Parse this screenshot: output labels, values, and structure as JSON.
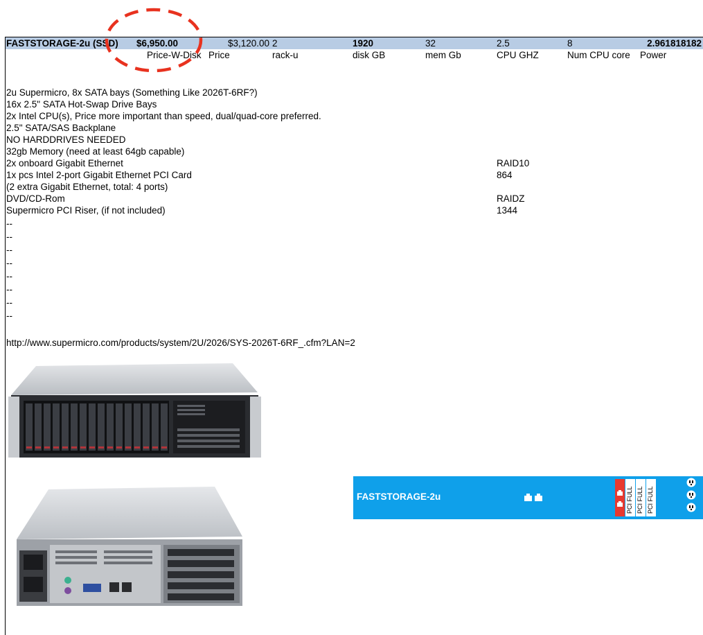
{
  "header_row": {
    "name": "FASTSTORAGE-2u",
    "tag": "(SSD)",
    "price_w_disk": "$6,950.00",
    "price": "$3,120.00",
    "rack_u": "2",
    "disk_gb": "1920",
    "mem_gb": "32",
    "cpu_ghz": "2.5",
    "num_cpu_core": "8",
    "power": "2.961818182"
  },
  "label_row": {
    "price_w_disk": "Price-W-Disk",
    "price": "Price",
    "rack_u": "rack-u",
    "disk_gb": "disk GB",
    "mem_gb": "mem Gb",
    "cpu_ghz": "CPU GHZ",
    "num_cpu_core": "Num CPU core",
    "power": "Power"
  },
  "description": [
    "2u Supermicro, 8x SATA bays (Something Like 2026T-6RF?)",
    " 16x 2.5\" SATA Hot-Swap Drive Bays",
    "2x Intel CPU(s), Price more important than speed, dual/quad-core preferred.",
    "2.5\" SATA/SAS Backplane",
    " NO HARDDRIVES NEEDED",
    "32gb Memory (need at least 64gb capable)",
    "2x onboard Gigabit Ethernet",
    "1x pcs Intel 2-port Gigabit Ethernet PCI Card",
    " (2 extra Gigabit Ethernet, total: 4 ports)",
    "DVD/CD-Rom",
    "Supermicro PCI Riser, (if not included)",
    "--",
    "--",
    "--",
    "--",
    "--",
    "--",
    "--",
    "--"
  ],
  "raid": {
    "raid10_label": "RAID10",
    "raid10_value": "864",
    "raidz_label": "RAIDZ",
    "raidz_value": "1344"
  },
  "link": "http://www.supermicro.com/products/system/2U/2026/SYS-2026T-6RF_.cfm?LAN=2",
  "rack_diagram": {
    "title": "FASTSTORAGE-2u",
    "pci_labels": [
      "PCI FULL",
      "PCI FULL",
      "PCI FULL"
    ],
    "colors": {
      "background": "#0fa0ea",
      "pci_red": "#e8392f"
    }
  },
  "annotation": {
    "color": "#e8321f"
  }
}
